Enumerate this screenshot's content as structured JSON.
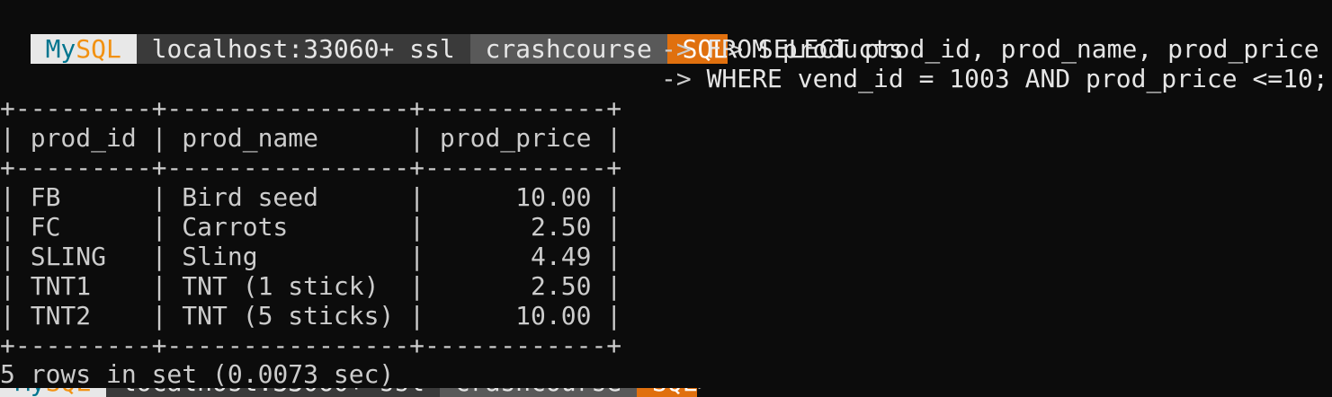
{
  "prompt": {
    "brand_my": "My",
    "brand_sql": "SQL",
    "host": "localhost:33060+ ssl",
    "schema": "crashcourse",
    "mode": "SQL",
    "prompt_char": ">",
    "continuation_char": "->"
  },
  "query": {
    "line1": "SELECT prod_id, prod_name, prod_price",
    "line2": "FROM products",
    "line3": "WHERE vend_id = 1003 AND prod_price <=10;"
  },
  "result_table": {
    "headers": [
      "prod_id",
      "prod_name",
      "prod_price"
    ],
    "rows": [
      [
        "FB",
        "Bird seed",
        "10.00"
      ],
      [
        "FC",
        "Carrots",
        "2.50"
      ],
      [
        "SLING",
        "Sling",
        "4.49"
      ],
      [
        "TNT1",
        "TNT (1 stick)",
        "2.50"
      ],
      [
        "TNT2",
        "TNT (5 sticks)",
        "10.00"
      ]
    ]
  },
  "status": "5 rows in set (0.0073 sec)",
  "colors": {
    "background": "#0c0c0c",
    "mysql_blue": "#00758f",
    "mysql_orange": "#f29111",
    "mode_orange": "#e0700e"
  }
}
